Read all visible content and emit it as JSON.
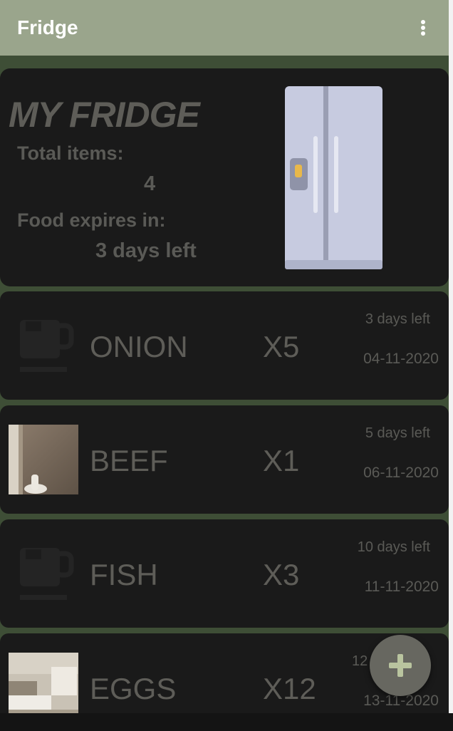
{
  "appbar": {
    "title": "Fridge",
    "menu_icon": "more-vert-icon"
  },
  "summary": {
    "title": "MY FRIDGE",
    "total_items_label": "Total items:",
    "total_items_value": "4",
    "expires_label": "Food expires in:",
    "expires_value": "3 days left",
    "image_icon": "fridge-icon"
  },
  "items": [
    {
      "name": "ONION",
      "qty": "X5",
      "days_left": "3 days left",
      "date": "04-11-2020",
      "image": "cup-placeholder-icon"
    },
    {
      "name": "BEEF",
      "qty": "X1",
      "days_left": "5 days left",
      "date": "06-11-2020",
      "image": "room-photo"
    },
    {
      "name": "FISH",
      "qty": "X3",
      "days_left": "10 days left",
      "date": "11-11-2020",
      "image": "cup-placeholder-icon"
    },
    {
      "name": "EGGS",
      "qty": "X12",
      "days_left": "12",
      "date": "13-11-2020",
      "image": "living-room-photo"
    }
  ],
  "fab": {
    "icon": "plus-icon"
  },
  "colors": {
    "appbar": "#9aa58c",
    "background": "#3e4e36",
    "card": "#1a1a1a",
    "text": "#5e5d58",
    "fab": "#676760",
    "fab_icon": "#b9c49f"
  }
}
